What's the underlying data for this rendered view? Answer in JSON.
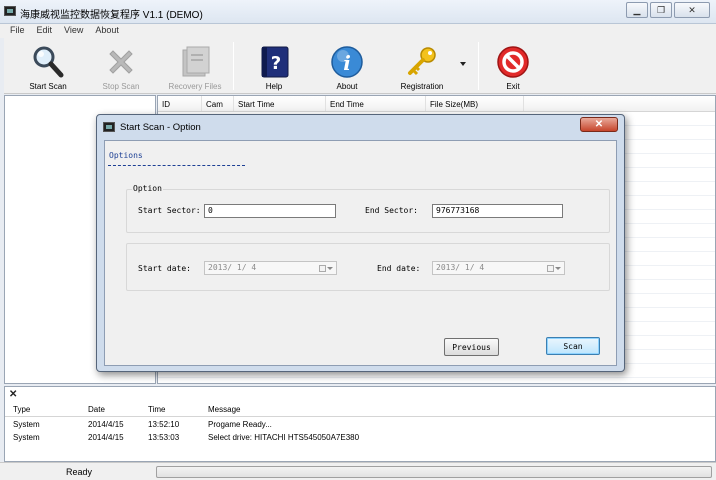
{
  "window": {
    "title": "海康威视监控数据恢复程序 V1.1 (DEMO)"
  },
  "menu": [
    "File",
    "Edit",
    "View",
    "About"
  ],
  "toolbar": {
    "start_scan": "Start Scan",
    "stop_scan": "Stop Scan",
    "recovery_files": "Recovery Files",
    "help": "Help",
    "about": "About",
    "registration": "Registration",
    "exit": "Exit"
  },
  "grid": {
    "columns": [
      "ID",
      "Cam",
      "Start Time",
      "End Time",
      "File Size(MB)"
    ]
  },
  "dialog": {
    "title": "Start Scan - Option",
    "tab": "Options",
    "group_title": "Option",
    "start_sector_label": "Start Sector:",
    "start_sector_value": "0",
    "end_sector_label": "End Sector:",
    "end_sector_value": "976773168",
    "start_date_label": "Start date:",
    "start_date_value": "2013/ 1/ 4",
    "end_date_label": "End date:",
    "end_date_value": "2013/ 1/ 4",
    "previous_button": "Previous",
    "scan_button": "Scan"
  },
  "log": {
    "columns": [
      "Type",
      "Date",
      "Time",
      "Message"
    ],
    "rows": [
      {
        "type": "System",
        "date": "2014/4/15",
        "time": "13:52:10",
        "message": "Progame Ready..."
      },
      {
        "type": "System",
        "date": "2014/4/15",
        "time": "13:53:03",
        "message": "Select drive: HITACHI HTS545050A7E380"
      }
    ]
  },
  "status": {
    "text": "Ready",
    "progress": 0
  },
  "colors": {
    "accent": "#3c7fb1",
    "dialog_frame": "#cfdcec",
    "close_red": "#c6452c",
    "progress_green": "#37b44a"
  }
}
